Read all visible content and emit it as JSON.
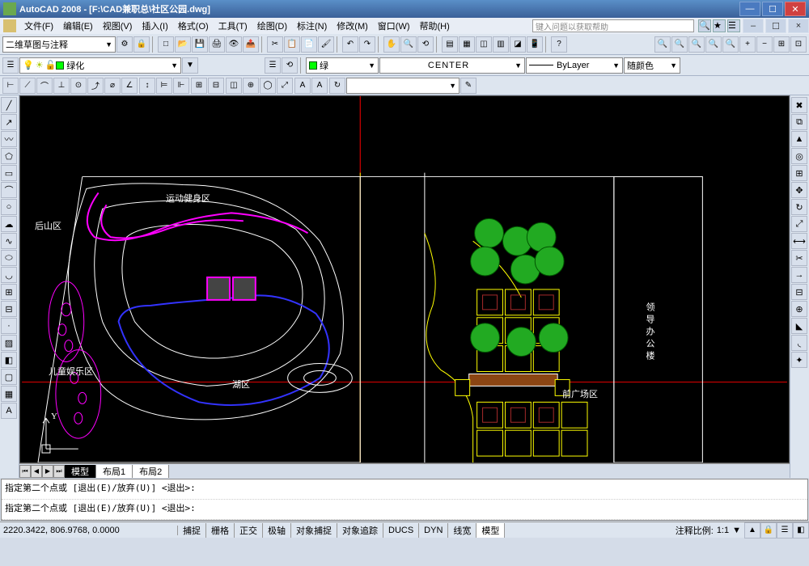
{
  "window": {
    "title": "AutoCAD 2008 - [F:\\CAD兼职总\\社区公园.dwg]"
  },
  "menu": {
    "items": [
      "文件(F)",
      "编辑(E)",
      "视图(V)",
      "插入(I)",
      "格式(O)",
      "工具(T)",
      "绘图(D)",
      "标注(N)",
      "修改(M)",
      "窗口(W)",
      "帮助(H)"
    ],
    "help_placeholder": "键入问题以获取帮助"
  },
  "toolbar1": {
    "workspace": "二维草图与注释"
  },
  "toolbar2": {
    "layer": "绿化",
    "color_label": "绿",
    "linetype": "CENTER",
    "lineweight": "ByLayer",
    "extra": "随颜色"
  },
  "canvas": {
    "labels": {
      "sports": "运动健身区",
      "mountain": "后山区",
      "children": "儿童娱乐区",
      "lake": "湖区",
      "front": "前广场区",
      "office": "领导办公楼"
    },
    "ucs_y": "Y"
  },
  "tabs": {
    "model": "模型",
    "layout1": "布局1",
    "layout2": "布局2"
  },
  "cmd": {
    "line1": "指定第二个点或 [退出(E)/放弃(U)] <退出>:",
    "line2": "指定第二个点或 [退出(E)/放弃(U)] <退出>:"
  },
  "status": {
    "coords": "2220.3422, 806.9768, 0.0000",
    "buttons": [
      "捕捉",
      "栅格",
      "正交",
      "极轴",
      "对象捕捉",
      "对象追踪",
      "DUCS",
      "DYN",
      "线宽",
      "模型"
    ],
    "anno_label": "注释比例:",
    "anno_value": "1:1"
  }
}
